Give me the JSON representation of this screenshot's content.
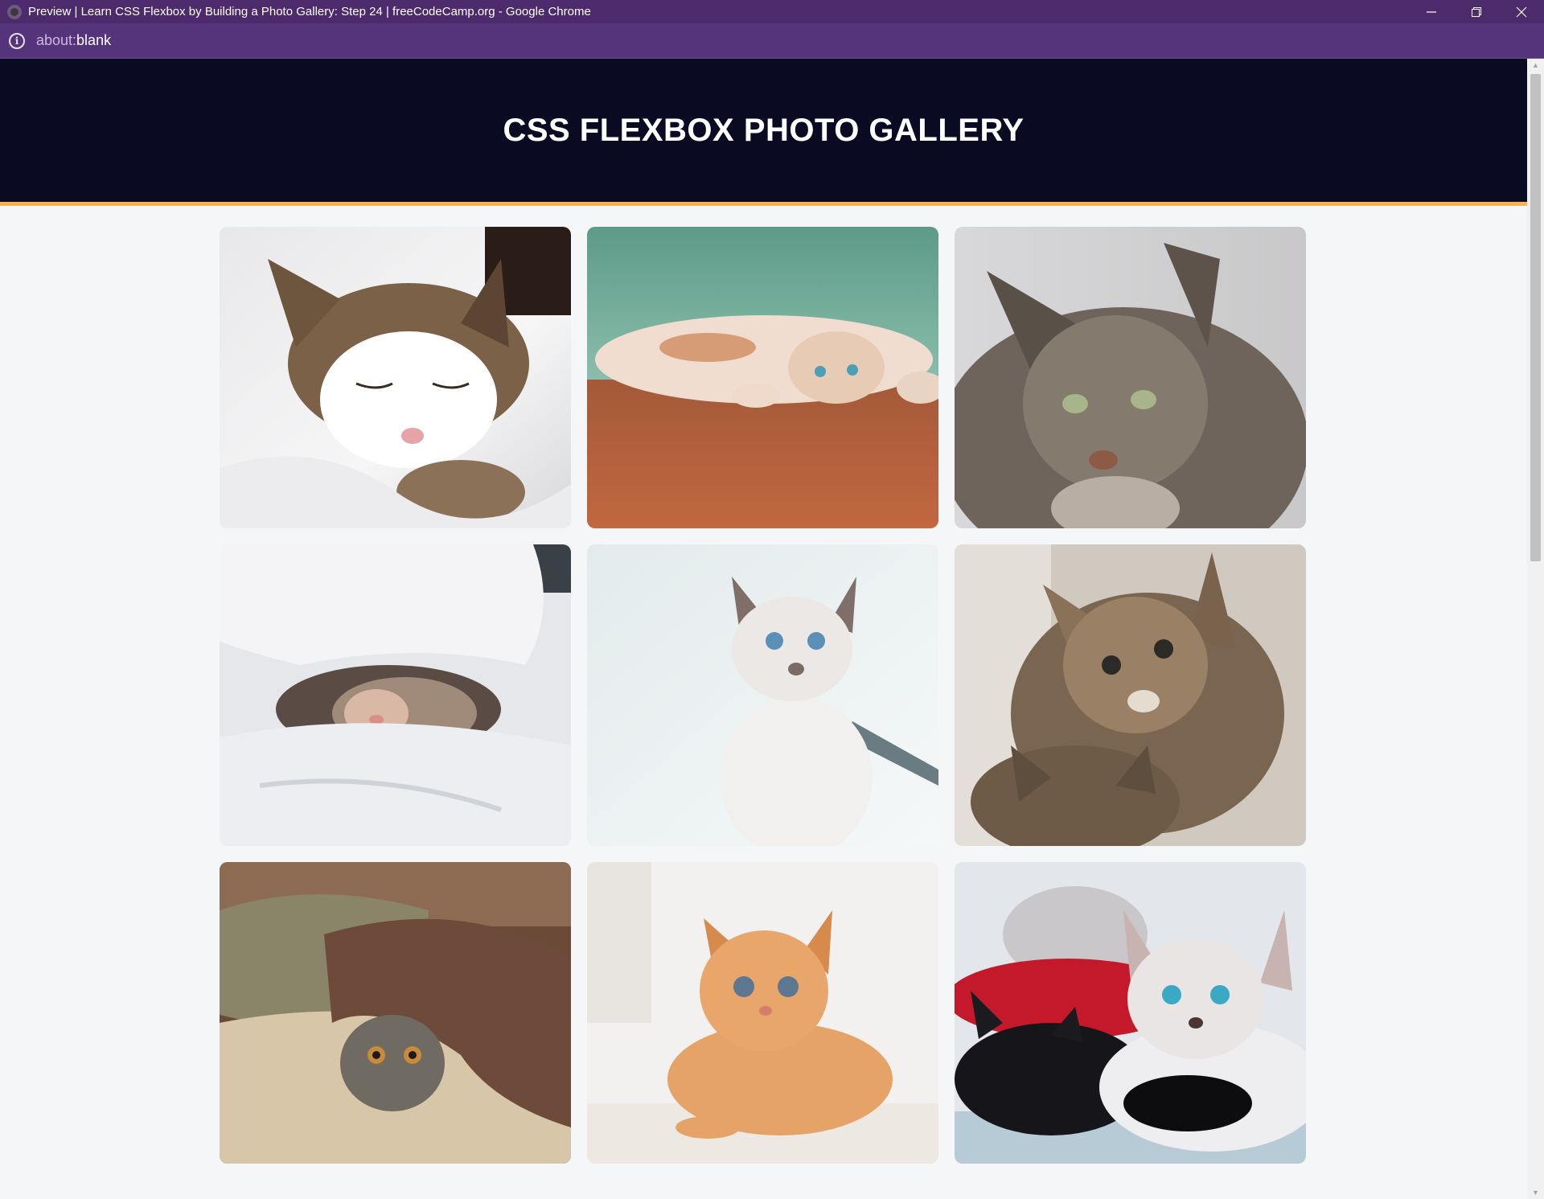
{
  "window": {
    "title": "Preview | Learn CSS Flexbox by Building a Photo Gallery: Step 24 | freeCodeCamp.org - Google Chrome",
    "favicon": "globe-icon",
    "controls": [
      "minimize-icon",
      "restore-icon",
      "close-icon"
    ]
  },
  "addressbar": {
    "icon": "info-icon",
    "url_scheme": "about:",
    "url_path": "blank"
  },
  "page": {
    "heading": "CSS FLEXBOX PHOTO GALLERY",
    "colors": {
      "header_bg": "#0a0a23",
      "header_border": "#fdb147",
      "page_bg": "#f5f6f7",
      "titlebar": "#4d2a6b",
      "addressbar": "#56347c"
    },
    "gallery": {
      "images": [
        {
          "name": "cat-sleeping-in-bed-image"
        },
        {
          "name": "cat-lying-on-wood-floor-image"
        },
        {
          "name": "tabby-cat-portrait-image"
        },
        {
          "name": "cat-under-white-blanket-image"
        },
        {
          "name": "white-kitten-by-window-image"
        },
        {
          "name": "tabby-kittens-image"
        },
        {
          "name": "cat-under-brown-blanket-image"
        },
        {
          "name": "orange-kitten-image"
        },
        {
          "name": "black-and-white-kittens-image"
        }
      ]
    }
  }
}
